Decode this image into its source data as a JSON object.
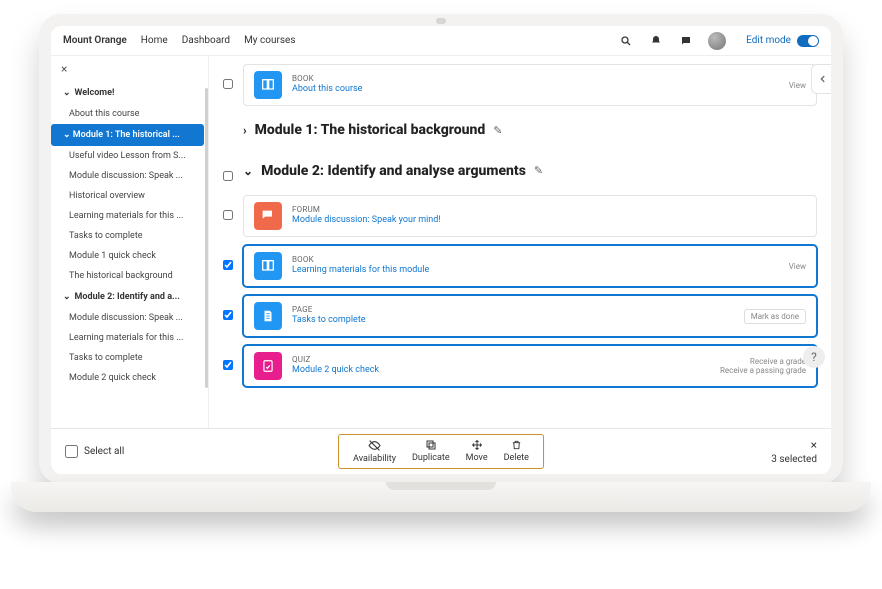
{
  "header": {
    "brand": "Mount Orange",
    "nav": [
      "Home",
      "Dashboard",
      "My courses"
    ],
    "edit_mode_label": "Edit mode"
  },
  "sidebar": {
    "sections": [
      {
        "heading": "Welcome!",
        "items": [
          "About this course"
        ]
      },
      {
        "heading": "Module 1: The historical ...",
        "active": true,
        "items": [
          "Useful video Lesson from S...",
          "Module discussion: Speak ...",
          "Historical overview",
          "Learning materials for this ...",
          "Tasks to complete",
          "Module 1 quick check",
          "The historical background"
        ]
      },
      {
        "heading": "Module 2: Identify and a...",
        "items": [
          "Module discussion: Speak ...",
          "Learning materials for this ...",
          "Tasks to complete",
          "Module 2 quick check"
        ]
      }
    ]
  },
  "main": {
    "top_activity": {
      "type": "BOOK",
      "title": "About this course",
      "action": "View",
      "checked": false,
      "icon": "book"
    },
    "section1": {
      "title": "Module 1: The historical background",
      "collapsed": true
    },
    "section2": {
      "title": "Module 2: Identify and analyse arguments",
      "collapsed": false,
      "activities": [
        {
          "type": "FORUM",
          "title": "Module discussion: Speak your mind!",
          "action": "",
          "checked": false,
          "icon": "forum"
        },
        {
          "type": "BOOK",
          "title": "Learning materials for this module",
          "action": "View",
          "checked": true,
          "icon": "book"
        },
        {
          "type": "PAGE",
          "title": "Tasks to complete",
          "action": "Mark as done",
          "action_style": "pill",
          "checked": true,
          "icon": "page"
        },
        {
          "type": "QUIZ",
          "title": "Module 2 quick check",
          "action": "Receive a grade",
          "action2": "Receive a passing grade",
          "checked": true,
          "icon": "quiz"
        }
      ]
    }
  },
  "bulkbar": {
    "select_all": "Select all",
    "actions": [
      {
        "label": "Availability",
        "icon": "eye-off"
      },
      {
        "label": "Duplicate",
        "icon": "copy"
      },
      {
        "label": "Move",
        "icon": "move"
      },
      {
        "label": "Delete",
        "icon": "trash"
      }
    ],
    "count_label": "3 selected"
  }
}
